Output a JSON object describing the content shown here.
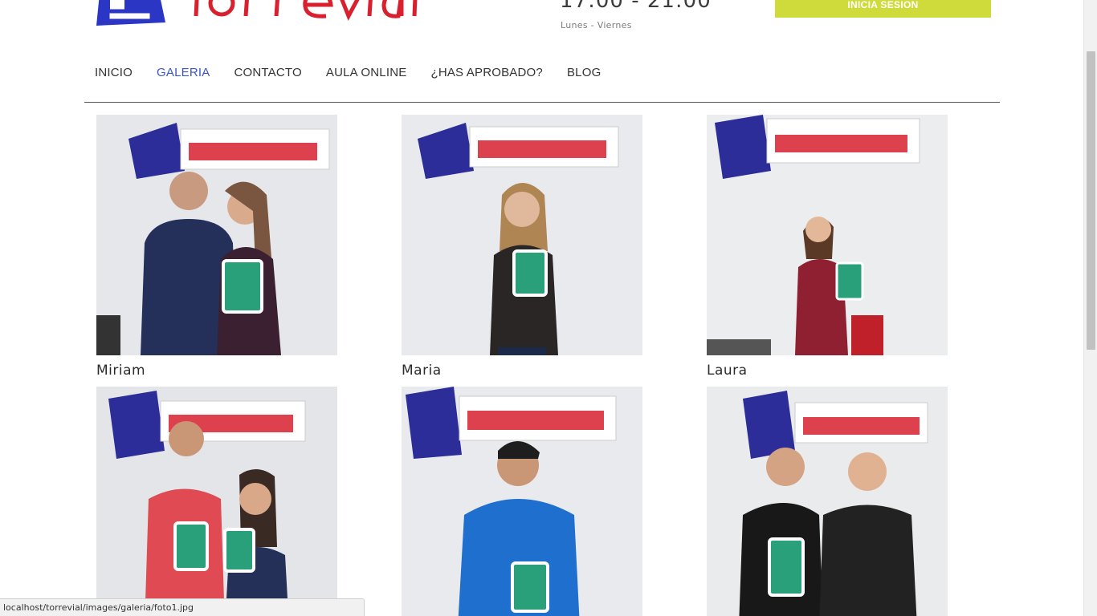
{
  "header": {
    "hours": "17:00 - 21:00",
    "days": "Lunes - Viernes",
    "login_label": "INICIA SESION"
  },
  "nav": {
    "items": [
      {
        "label": "INICIO"
      },
      {
        "label": "GALERIA"
      },
      {
        "label": "CONTACTO"
      },
      {
        "label": "AULA ONLINE"
      },
      {
        "label": "¿HAS APROBADO?"
      },
      {
        "label": "BLOG"
      }
    ],
    "active_index": 1
  },
  "gallery": {
    "items": [
      {
        "name": "Miriam"
      },
      {
        "name": "Maria"
      },
      {
        "name": "Laura"
      },
      {
        "name": ""
      },
      {
        "name": ""
      },
      {
        "name": ""
      }
    ]
  },
  "status_bar": {
    "url": "localhost/torrevial/images/galeria/foto1.jpg"
  },
  "colors": {
    "accent_button": "#cfdb3a",
    "nav_active": "#3a55c7",
    "logo_blue": "#2b36c4",
    "logo_red": "#d8202f"
  }
}
